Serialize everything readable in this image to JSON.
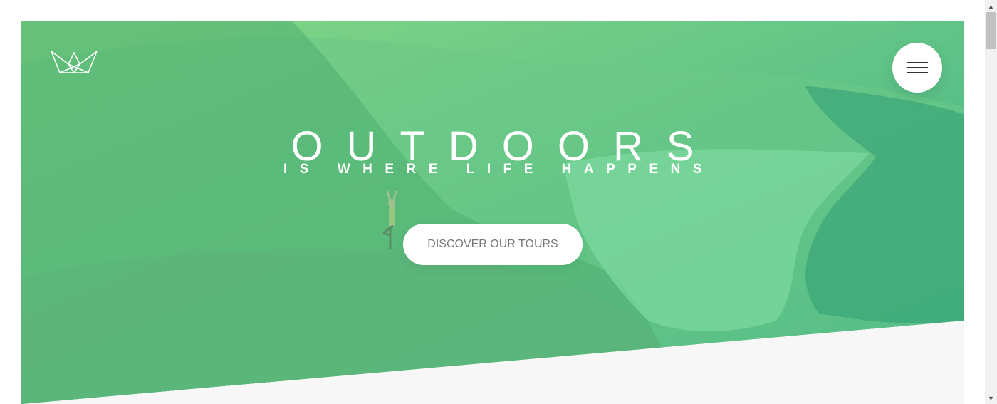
{
  "hero": {
    "title": "OUTDOORS",
    "subtitle": "IS WHERE LIFE HAPPENS",
    "cta_label": "DISCOVER OUR TOURS",
    "gradient_start": "#7ed56f",
    "gradient_end": "#28b485"
  },
  "header": {
    "logo_icon": "crown-logo-icon",
    "menu_icon": "hamburger-menu-icon"
  },
  "scrollbar": {
    "up_arrow": "▲",
    "down_arrow": "▼"
  }
}
